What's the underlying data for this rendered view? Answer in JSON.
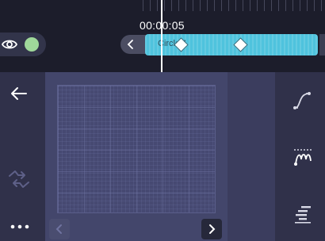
{
  "timeline": {
    "current_time": "00:00:05",
    "clip_label": "Circle 1",
    "clip_color": "#4fc3dd"
  },
  "layer": {
    "visibility_icon": "eye-icon",
    "color_swatch": "#9fd89a"
  },
  "left_toolbar": {
    "items": [
      "back-arrow-icon",
      "swap-icon",
      "more-icon"
    ]
  },
  "right_toolbar": {
    "items": [
      "easing-curve-icon",
      "motion-path-icon",
      "align-icon"
    ]
  },
  "canvas": {
    "prev_icon": "chevron-left-icon",
    "next_icon": "chevron-right-icon"
  }
}
